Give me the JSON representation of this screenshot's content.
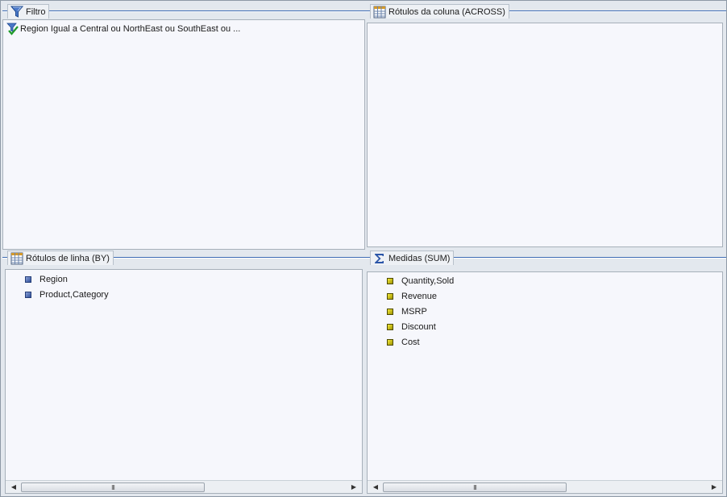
{
  "filter_pane": {
    "title": "Filtro",
    "icon": "funnel-icon",
    "items": [
      {
        "label": "Region Igual a Central ou NorthEast ou SouthEast ou ...",
        "icon": "filter-check-icon"
      }
    ]
  },
  "across_pane": {
    "title": "Rótulos da coluna (ACROSS)",
    "icon": "grid-columns-icon",
    "items": []
  },
  "by_pane": {
    "title": "Rótulos de linha (BY)",
    "icon": "grid-rows-icon",
    "items": [
      {
        "label": "Region"
      },
      {
        "label": "Product,Category"
      }
    ],
    "scroll_grip": "III"
  },
  "measures_pane": {
    "title": "Medidas (SUM)",
    "icon": "sigma-icon",
    "items": [
      {
        "label": "Quantity,Sold"
      },
      {
        "label": "Revenue"
      },
      {
        "label": "MSRP"
      },
      {
        "label": "Discount"
      },
      {
        "label": "Cost"
      }
    ],
    "scroll_grip": "III"
  },
  "colors": {
    "accent_line": "#3d6bb3",
    "pane_body": "#f6f7fc",
    "dimension_bullet": "#2f4f9a",
    "measure_bullet": "#d8cc10"
  }
}
